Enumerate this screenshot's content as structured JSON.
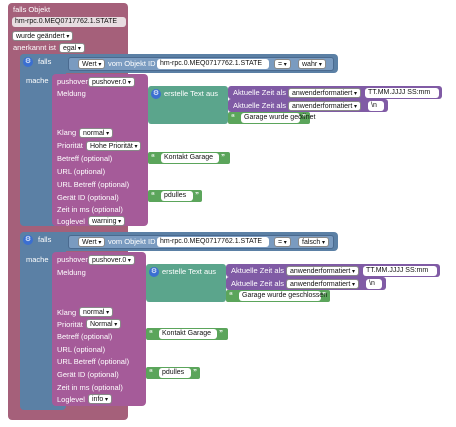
{
  "outer": {
    "if_label": "falls Objekt",
    "object_id": "hm-rpc.0.MEQ0717762.1.STATE",
    "changed_label": "wurde geändert",
    "ack_label": "anerkannt ist",
    "ack_value": "egal"
  },
  "block1": {
    "if_label": "falls",
    "do_label": "mache",
    "cond": {
      "attr": "Wert",
      "from_label": "vom Objekt ID",
      "object_id": "hm-rpc.0.MEQ0717762.1.STATE",
      "op": "=",
      "value": "wahr"
    },
    "pushover": {
      "label": "pushover",
      "instance": "pushover.0",
      "message_label": "Meldung",
      "create_text": "erstelle Text aus",
      "time1_label": "Aktuelle Zeit als",
      "time1_format": "anwenderformatiert",
      "time1_pattern": "TT.MM.JJJJ SS:mm",
      "time2_label": "Aktuelle Zeit als",
      "time2_format": "anwenderformatiert",
      "time2_pattern": "\\n",
      "text": "Garage wurde geöffnet",
      "sound_label": "Klang",
      "sound": "normal",
      "priority_label": "Priorität",
      "priority": "Hohe Priorität",
      "subject_label": "Betreff (optional)",
      "subject": "Kontakt Garage",
      "url_label": "URL (optional)",
      "url_title_label": "URL Betreff (optional)",
      "device_label": "Gerät ID (optional)",
      "device": "pdulles",
      "ttl_label": "Zeit in ms (optional)",
      "loglevel_label": "Loglevel",
      "loglevel": "warning"
    }
  },
  "block2": {
    "if_label": "falls",
    "do_label": "mache",
    "cond": {
      "attr": "Wert",
      "from_label": "vom Objekt ID",
      "object_id": "hm-rpc.0.MEQ0717762.1.STATE",
      "op": "=",
      "value": "falsch"
    },
    "pushover": {
      "label": "pushover",
      "instance": "pushover.0",
      "message_label": "Meldung",
      "create_text": "erstelle Text aus",
      "time1_label": "Aktuelle Zeit als",
      "time1_format": "anwenderformatiert",
      "time1_pattern": "TT.MM.JJJJ SS:mm",
      "time2_label": "Aktuelle Zeit als",
      "time2_format": "anwenderformatiert",
      "time2_pattern": "\\n",
      "text": "Garage wurde geschlossen",
      "sound_label": "Klang",
      "sound": "normal",
      "priority_label": "Priorität",
      "priority": "Normal",
      "subject_label": "Betreff (optional)",
      "subject": "Kontakt Garage",
      "url_label": "URL (optional)",
      "url_title_label": "URL Betreff (optional)",
      "device_label": "Gerät ID (optional)",
      "device": "pdulles",
      "ttl_label": "Zeit in ms (optional)",
      "loglevel_label": "Loglevel",
      "loglevel": "info"
    }
  },
  "colors": {
    "event_block": "#a5607a",
    "if_block": "#5b80a5",
    "pushover_block": "#a55b99",
    "text_block": "#5ba58c",
    "time_block": "#805ba5",
    "string_block": "#5ba55b",
    "gear": "#3b6fd1"
  }
}
